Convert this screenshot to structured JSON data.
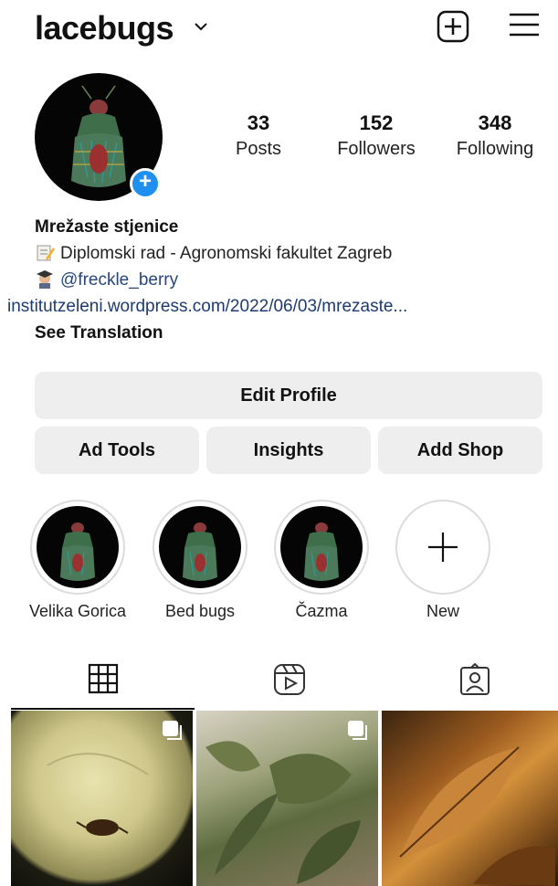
{
  "header": {
    "username": "lacebugs",
    "chevron_icon": "chevron-down-icon",
    "new_post_icon": "plus-square-icon",
    "menu_icon": "hamburger-menu-icon"
  },
  "profile": {
    "avatar_icon": "lace-bug-avatar",
    "add_story_icon": "plus-icon",
    "stats": {
      "posts": {
        "value": "33",
        "label": "Posts"
      },
      "followers": {
        "value": "152",
        "label": "Followers"
      },
      "following": {
        "value": "348",
        "label": "Following"
      }
    },
    "bio": {
      "name": "Mrežaste stjenice",
      "line1": "Diplomski rad - Agronomski fakultet Zagreb",
      "line1_icon": "memo-emoji",
      "mention": "@freckle_berry",
      "mention_icon": "student-emoji",
      "link": "institutzeleni.wordpress.com/2022/06/03/mrezaste...",
      "translate": "See Translation"
    }
  },
  "buttons": {
    "edit_profile": "Edit Profile",
    "ad_tools": "Ad Tools",
    "insights": "Insights",
    "add_shop": "Add Shop"
  },
  "highlights": [
    {
      "label": "Velika Gorica"
    },
    {
      "label": "Bed bugs"
    },
    {
      "label": "Čazma"
    },
    {
      "label": "New"
    }
  ],
  "tabs": [
    {
      "icon": "grid-icon",
      "active": true
    },
    {
      "icon": "reels-icon",
      "active": false
    },
    {
      "icon": "tagged-icon",
      "active": false
    }
  ],
  "posts": [
    {
      "icon": "carousel-icon",
      "multi": true
    },
    {
      "icon": "carousel-icon",
      "multi": true
    },
    {
      "multi": false
    }
  ],
  "colors": {
    "accent_blue": "#1f8ff0",
    "link_blue": "#1e3a6e",
    "button_bg": "#eeeeef"
  }
}
